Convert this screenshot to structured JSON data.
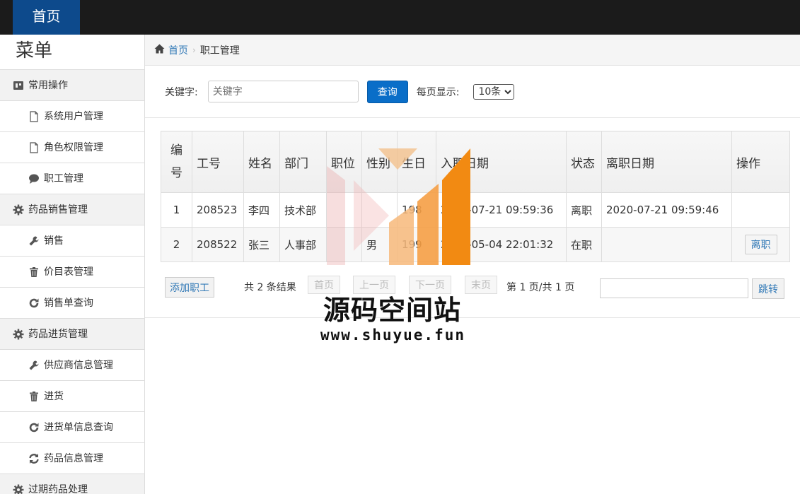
{
  "topbar": {
    "brand": "首页"
  },
  "sidebar": {
    "title": "菜单",
    "groups": [
      {
        "label": "常用操作",
        "icon": "dashboard-icon",
        "items": [
          {
            "label": "系统用户管理",
            "icon": "file-icon"
          },
          {
            "label": "角色权限管理",
            "icon": "file-icon"
          },
          {
            "label": "职工管理",
            "icon": "comment-icon"
          }
        ]
      },
      {
        "label": "药品销售管理",
        "icon": "gear-icon",
        "items": [
          {
            "label": "销售",
            "icon": "wrench-icon"
          },
          {
            "label": "价目表管理",
            "icon": "trash-icon"
          },
          {
            "label": "销售单查询",
            "icon": "refresh-icon"
          }
        ]
      },
      {
        "label": "药品进货管理",
        "icon": "gear-icon",
        "items": [
          {
            "label": "供应商信息管理",
            "icon": "wrench-icon"
          },
          {
            "label": "进货",
            "icon": "trash-icon"
          },
          {
            "label": "进货单信息查询",
            "icon": "refresh-icon"
          },
          {
            "label": "药品信息管理",
            "icon": "sync-icon"
          }
        ]
      },
      {
        "label": "过期药品处理",
        "icon": "gear-icon",
        "items": []
      }
    ]
  },
  "breadcrumb": {
    "home": "首页",
    "current": "职工管理"
  },
  "search": {
    "keyword_label": "关键字:",
    "keyword_placeholder": "关键字",
    "query_button": "查询",
    "page_size_label": "每页显示:",
    "page_size_selected": "10条"
  },
  "table": {
    "headers": [
      "编号",
      "工号",
      "姓名",
      "部门",
      "职位",
      "性别",
      "生日",
      "入职日期",
      "状态",
      "离职日期",
      "操作"
    ],
    "rows": [
      [
        "1",
        "208523",
        "李四",
        "技术部",
        "",
        "",
        "198",
        "2020-07-21 09:59:36",
        "离职",
        "2020-07-21 09:59:46",
        ""
      ],
      [
        "2",
        "208522",
        "张三",
        "人事部",
        "",
        "男",
        "199",
        "2020-05-04 22:01:32",
        "在职",
        "",
        "离职"
      ]
    ]
  },
  "pager": {
    "add_button": "添加职工",
    "total_text": "共 2 条结果",
    "first": "首页",
    "prev": "上一页",
    "next": "下一页",
    "last": "末页",
    "page_info": "第 1 页/共 1 页",
    "jump_button": "跳转"
  },
  "watermark": {
    "text": "源码空间站",
    "url": "www.shuyue.fun"
  },
  "colors": {
    "brand": "#0d4a8c",
    "topbar": "#1b1b1b",
    "primary": "#0a6ec8",
    "link": "#337ab7"
  }
}
